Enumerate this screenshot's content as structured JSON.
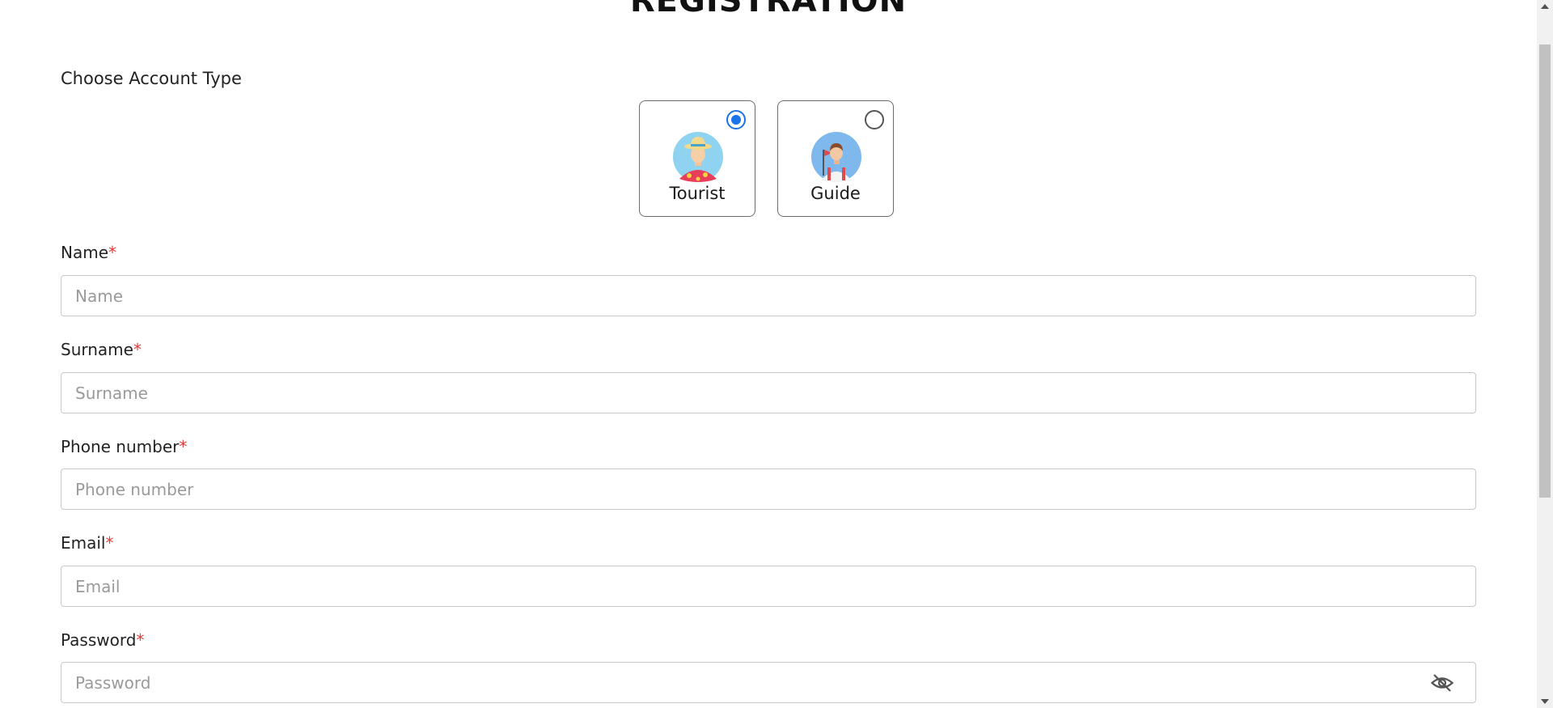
{
  "page": {
    "title": "REGISTRATION"
  },
  "account_type": {
    "heading": "Choose Account Type",
    "options": [
      {
        "label": "Tourist",
        "selected": true,
        "icon": "tourist-avatar-icon"
      },
      {
        "label": "Guide",
        "selected": false,
        "icon": "guide-avatar-icon"
      }
    ]
  },
  "fields": {
    "name": {
      "label": "Name",
      "required_mark": "*",
      "placeholder": "Name",
      "value": ""
    },
    "surname": {
      "label": "Surname",
      "required_mark": "*",
      "placeholder": "Surname",
      "value": ""
    },
    "phone": {
      "label": "Phone number",
      "required_mark": "*",
      "placeholder": "Phone number",
      "value": ""
    },
    "email": {
      "label": "Email",
      "required_mark": "*",
      "placeholder": "Email",
      "value": ""
    },
    "password": {
      "label": "Password",
      "required_mark": "*",
      "placeholder": "Password",
      "value": "",
      "visibility_icon": "eye-slash-icon"
    }
  },
  "colors": {
    "accent": "#1a73e8",
    "required": "#e53935",
    "border": "#c8c8c8"
  }
}
